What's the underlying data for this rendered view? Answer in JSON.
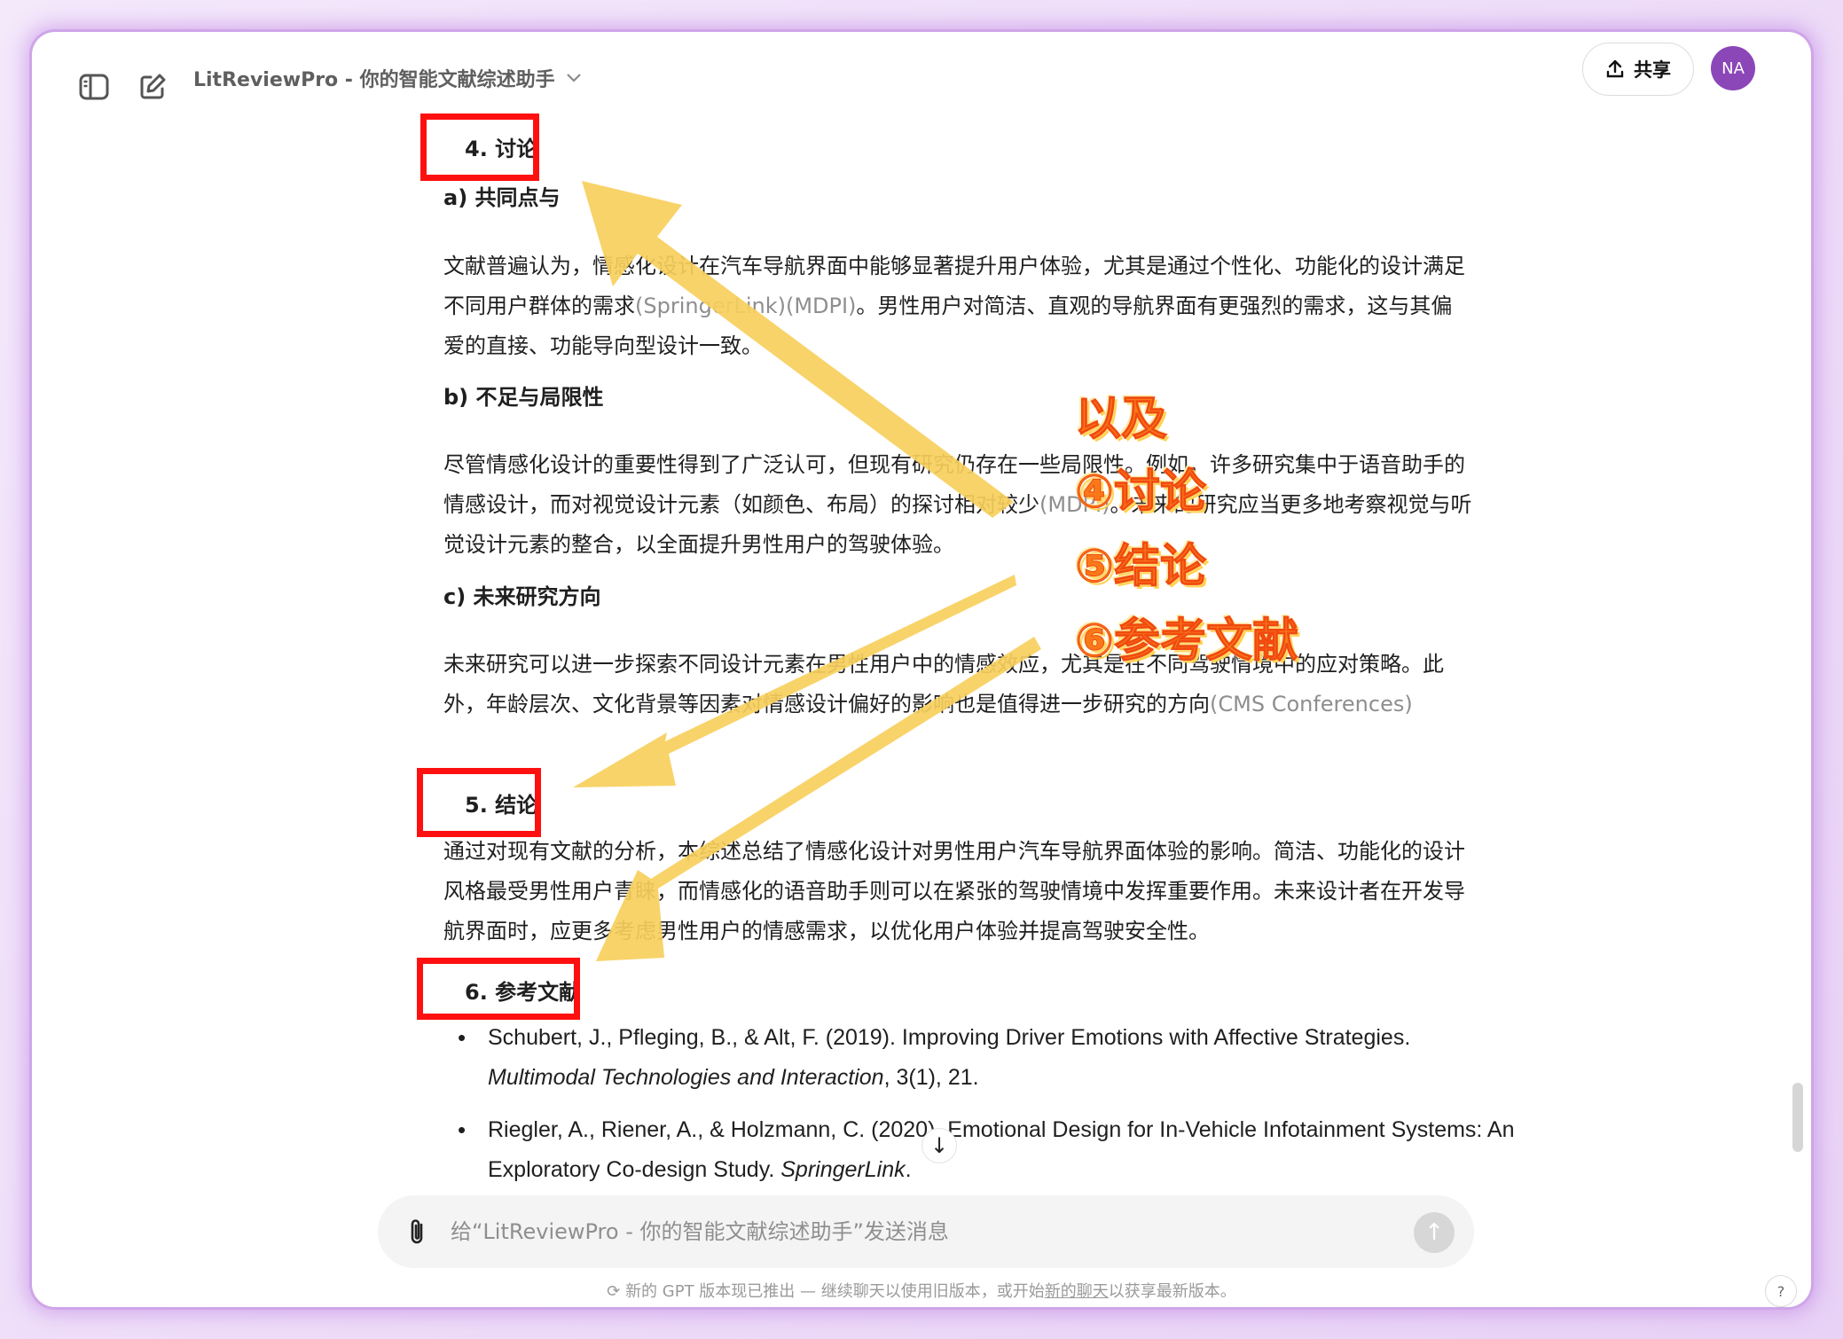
{
  "header": {
    "title": "LitReviewPro - 你的智能文献综述助手",
    "share_label": "共享",
    "avatar_initials": "NA"
  },
  "sections": {
    "discussion": {
      "heading": "4. 讨论",
      "a_heading": "a) 共同点与",
      "a_text": "文献普遍认为，情感化设计在汽车导航界面中能够显著提升用户体验，尤其是通过个性化、功能化的设计满足不同用户群体的需求",
      "a_cite": "(SpringerLink)(MDPI)",
      "a_text2": "。男性用户对简洁、直观的导航界面有更强烈的需求，这与其偏爱的直接、功能导向型设计一致。",
      "b_heading": "b) 不足与局限性",
      "b_text": "尽管情感化设计的重要性得到了广泛认可，但现有研究仍存在一些局限性。例如，许多研究集中于语音助手的情感设计，而对视觉设计元素（如颜色、布局）的探讨相对较少",
      "b_cite": "(MDPI)",
      "b_text2": "。未来的研究应当更多地考察视觉与听觉设计元素的整合，以全面提升男性用户的驾驶体验。",
      "c_heading": "c) 未来研究方向",
      "c_text": "未来研究可以进一步探索不同设计元素在男性用户中的情感效应，尤其是在不同驾驶情境中的应对策略。此外，年龄层次、文化背景等因素对情感设计偏好的影响也是值得进一步研究的方向",
      "c_cite": "(CMS Conferences)"
    },
    "conclusion": {
      "heading": "5. 结论",
      "text": "通过对现有文献的分析，本综述总结了情感化设计对男性用户汽车导航界面体验的影响。简洁、功能化的设计风格最受男性用户青睐，而情感化的语音助手则可以在紧张的驾驶情境中发挥重要作用。未来设计者在开发导航界面时，应更多考虑男性用户的情感需求，以优化用户体验并提高驾驶安全性。"
    },
    "references": {
      "heading": "6. 参考文献",
      "items": [
        {
          "authors": "Schubert, J., Pfleging, B., & Alt, F. (2019). Improving Driver Emotions with Affective Strategies. ",
          "journal": "Multimodal Technologies and Interaction",
          "tail": ", 3(1), 21."
        },
        {
          "authors": "Riegler, A., Riener, A., & Holzmann, C. (2020). Emotional Design for In-Vehicle Infotainment Systems: An Exploratory Co-design Study. ",
          "journal": "SpringerLink",
          "tail": "."
        }
      ]
    }
  },
  "annotations": {
    "line1": "以及",
    "line2": "④讨论",
    "line3": "⑤结论",
    "line4": "⑥参考文献",
    "arrow_color": "#f7cf5c",
    "box_color": "#ff1010"
  },
  "composer": {
    "placeholder": "给“LitReviewPro - 你的智能文献综述助手”发送消息"
  },
  "footer": {
    "text_before": "新的 GPT 版本现已推出 — 继续聊天以使用旧版本，或开始",
    "link": "新的聊天",
    "text_after": "以获享最新版本。"
  },
  "help_label": "?"
}
